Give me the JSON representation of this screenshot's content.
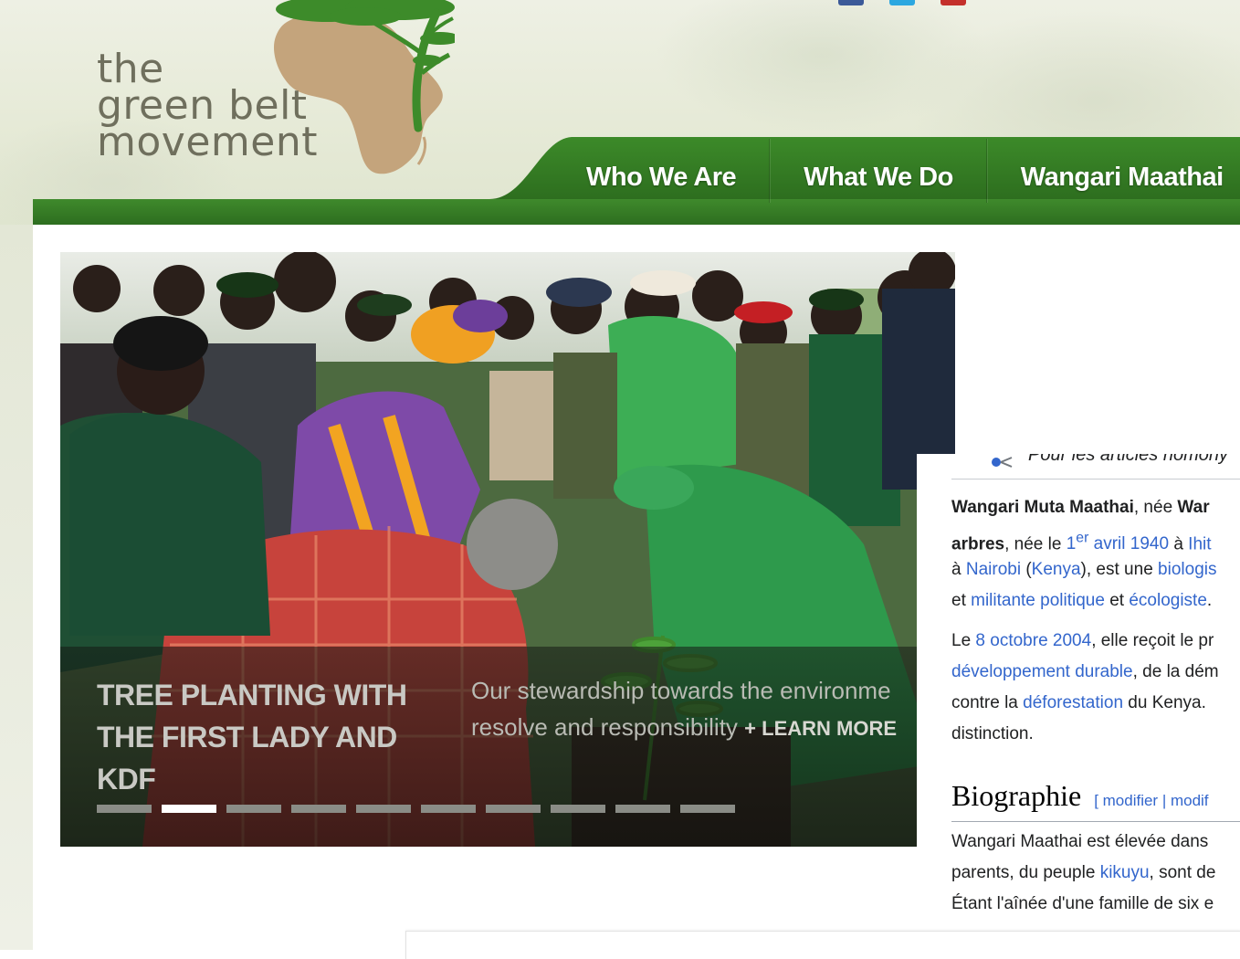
{
  "brand": {
    "logo_lines": [
      "the",
      "green belt",
      "movement"
    ]
  },
  "colors": {
    "nav_green": "#2f7422",
    "tree_green": "#3d8b2a",
    "africa_tan": "#c4a47c",
    "logo_text": "#6f6f5d",
    "wiki_link": "#3366cc"
  },
  "nav": {
    "items": [
      {
        "label": "Who We Are"
      },
      {
        "label": "What We Do"
      },
      {
        "label": "Wangari Maathai"
      }
    ]
  },
  "slider": {
    "title": "TREE PLANTING WITH THE FIRST LADY AND KDF",
    "text_line1": "Our stewardship towards the environme",
    "text_line2": "resolve and responsibility",
    "learn_more": "+ LEARN MORE",
    "dot_count": 10,
    "active_index": 1
  },
  "wiki": {
    "hatnote": "Pour les articles homony",
    "p1": {
      "line1_bold": "Wangari Muta Maathai",
      "line1_rest": ", née ",
      "line1_bold2": "War",
      "line2_bold": "arbres",
      "line2_a": ", née le ",
      "line2_link1": "1",
      "line2_sup": "er",
      "line2_link2": " avril 1940",
      "line2_b": " à ",
      "line2_link3": "Ihit",
      "line3_a": "à ",
      "line3_link1": "Nairobi",
      "line3_b": " (",
      "line3_link2": "Kenya",
      "line3_c": "), est une ",
      "line3_link3": "biologis",
      "line4_a": "et ",
      "line4_link1": "militante politique",
      "line4_b": " et ",
      "line4_link2": "écologiste",
      "line4_c": "."
    },
    "p2": {
      "line1_a": "Le ",
      "line1_link": "8 octobre 2004",
      "line1_b": ", elle reçoit le pr",
      "line2_link1": "développement durable",
      "line2_b": ", de la dém",
      "line3_a": "contre la ",
      "line3_link": "déforestation",
      "line3_b": " du Kenya.",
      "line4": "distinction."
    },
    "section_heading": "Biographie",
    "edit_links": "[ modifier | modif",
    "p3": {
      "line1": "Wangari Maathai est élevée dans",
      "line2_a": "parents, du peuple ",
      "line2_link": "kikuyu",
      "line2_b": ", sont de",
      "line3": "Étant l'aînée d'une famille de six e"
    }
  }
}
